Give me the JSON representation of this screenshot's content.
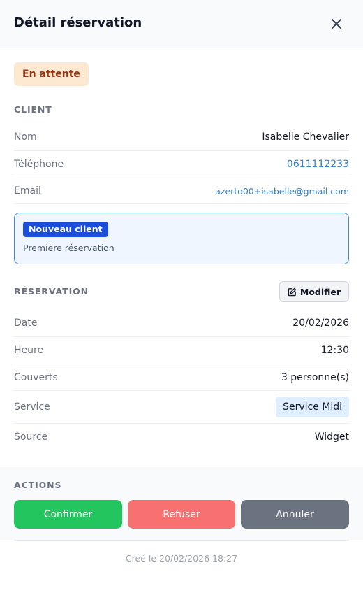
{
  "header": {
    "title": "Détail réservation",
    "close_icon": "close-icon"
  },
  "status": {
    "label": "En attente",
    "bg": "#fde9d2",
    "color": "#9a3412"
  },
  "client": {
    "section_title": "CLIENT",
    "name_label": "Nom",
    "name_value": "Isabelle Chevalier",
    "phone_label": "Téléphone",
    "phone_value": "0611112233",
    "email_label": "Email",
    "email_value": "azerto00+isabelle@gmail.com",
    "new_client_tag": "Nouveau client",
    "new_client_sub": "Première réservation"
  },
  "reservation": {
    "section_title": "RÉSERVATION",
    "modify_label": "Modifier",
    "modify_icon": "edit-icon",
    "date_label": "Date",
    "date_value": "20/02/2026",
    "time_label": "Heure",
    "time_value": "12:30",
    "covers_label": "Couverts",
    "covers_value": "3 personne(s)",
    "service_label": "Service",
    "service_value": "Service Midi",
    "source_label": "Source",
    "source_value": "Widget"
  },
  "actions": {
    "section_title": "ACTIONS",
    "confirm_label": "Confirmer",
    "refuse_label": "Refuser",
    "cancel_label": "Annuler",
    "colors": {
      "confirm": "#22c55e",
      "refuse": "#f87171",
      "cancel": "#6b7280"
    }
  },
  "footer": {
    "created": "Créé le 20/02/2026 18:27"
  }
}
